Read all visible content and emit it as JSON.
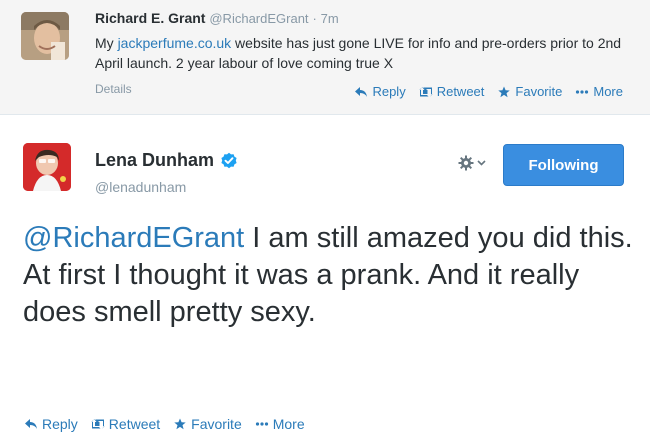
{
  "parent_tweet": {
    "author_name": "Richard E. Grant",
    "author_handle": "@RichardEGrant",
    "time_separator": "·",
    "time": "7m",
    "text_before_link": "My ",
    "link_text": "jackperfume.co.uk",
    "text_after_link": " website has just gone LIVE for info and pre-orders prior to 2nd April launch. 2 year labour of love coming true X",
    "details_label": "Details",
    "actions": {
      "reply": "Reply",
      "retweet": "Retweet",
      "favorite": "Favorite",
      "more": "More"
    }
  },
  "main_tweet": {
    "author_name": "Lena Dunham",
    "verified": true,
    "author_handle": "@lenadunham",
    "follow_button_label": "Following",
    "mention": "@RichardEGrant",
    "text_after_mention": " I am still amazed you did this. At first I thought it was a prank. And it really does smell pretty sexy.",
    "actions": {
      "reply": "Reply",
      "retweet": "Retweet",
      "favorite": "Favorite",
      "more": "More"
    }
  },
  "colors": {
    "link": "#2b7bb9",
    "follow_button": "#3a8ee0",
    "verified_badge": "#1da1f2",
    "muted_text": "#8899a6"
  },
  "icons": [
    "reply-icon",
    "retweet-icon",
    "favorite-star-icon",
    "more-dots-icon",
    "verified-badge-icon",
    "gear-icon",
    "chevron-down-icon"
  ]
}
